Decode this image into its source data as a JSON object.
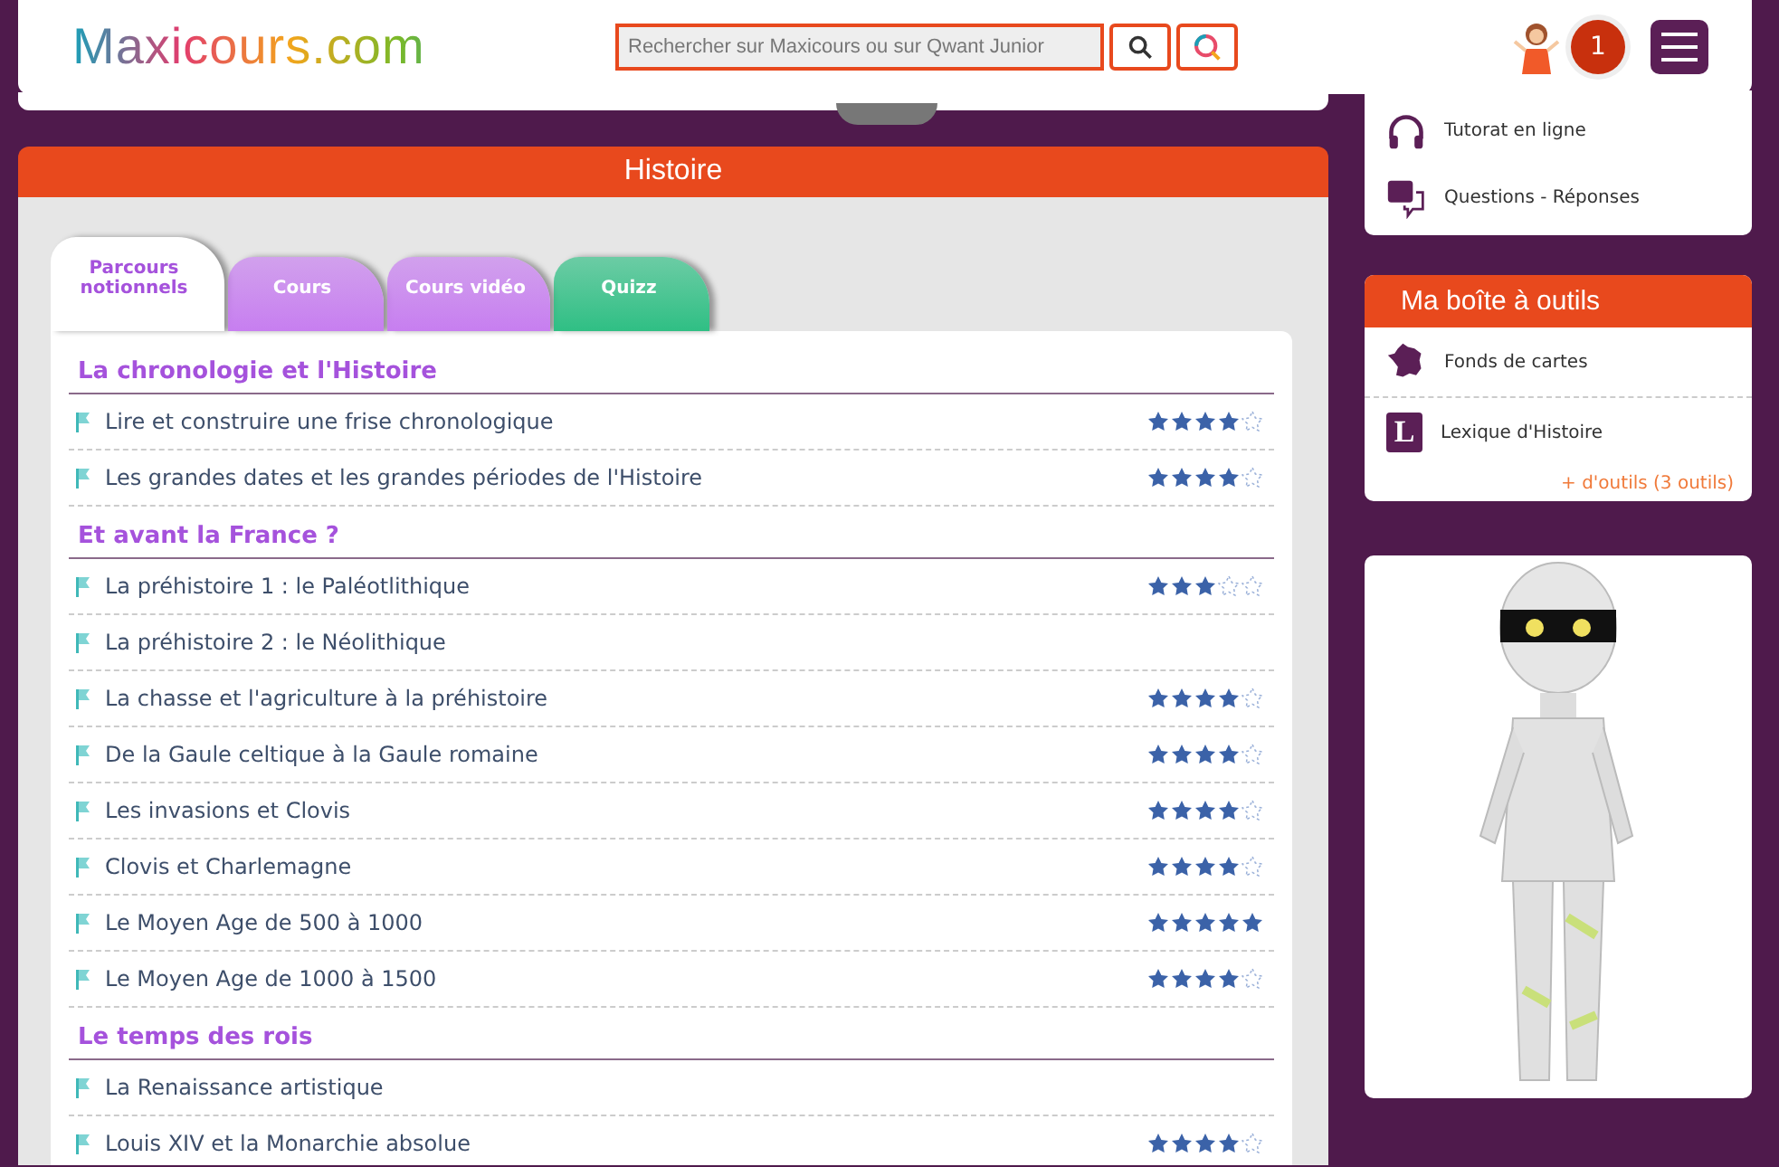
{
  "header": {
    "logo": "Maxicours.com",
    "search": {
      "placeholder": "Rechercher sur Maxicours ou sur Qwant Junior"
    },
    "notification_count": "1"
  },
  "subject": {
    "title": "Histoire"
  },
  "tabs": [
    {
      "label": "Parcours notionnels",
      "selected": true,
      "color": "#ffffff"
    },
    {
      "label": "Cours",
      "selected": false,
      "color": "#c77ef0"
    },
    {
      "label": "Cours vidéo",
      "selected": false,
      "color": "#c77ef0"
    },
    {
      "label": "Quizz",
      "selected": false,
      "color": "#2fbf84"
    }
  ],
  "sections": [
    {
      "title": "La chronologie et l'Histoire",
      "items": [
        {
          "label": "Lire et construire une frise chronologique",
          "stars": 4
        },
        {
          "label": "Les grandes dates et les grandes périodes de l'Histoire",
          "stars": 4
        }
      ]
    },
    {
      "title": "Et avant la France ?",
      "items": [
        {
          "label": "La préhistoire 1 : le Paléotlithique",
          "stars": 3
        },
        {
          "label": "La préhistoire 2 : le Néolithique"
        },
        {
          "label": "La chasse et l'agriculture à la préhistoire",
          "stars": 4
        },
        {
          "label": "De la Gaule celtique à la Gaule romaine",
          "stars": 4
        },
        {
          "label": "Les invasions et Clovis",
          "stars": 4
        },
        {
          "label": "Clovis et Charlemagne",
          "stars": 4
        },
        {
          "label": "Le Moyen Age de 500 à 1000",
          "stars": 5
        },
        {
          "label": "Le Moyen Age de 1000 à 1500",
          "stars": 4
        }
      ]
    },
    {
      "title": "Le temps des rois",
      "items": [
        {
          "label": "La Renaissance artistique"
        },
        {
          "label": "Louis XIV et la Monarchie absolue",
          "stars": 4
        }
      ]
    }
  ],
  "services": [
    {
      "kind": "headphones",
      "label": "Tutorat en ligne"
    },
    {
      "kind": "chat",
      "label": "Questions - Réponses"
    }
  ],
  "toolbox": {
    "title": "Ma boîte à outils",
    "items": [
      {
        "kind": "map",
        "label": "Fonds de cartes"
      },
      {
        "kind": "letter",
        "label": "Lexique d'Histoire",
        "letter": "L"
      }
    ],
    "more_link": "+ d'outils (3 outils)"
  }
}
